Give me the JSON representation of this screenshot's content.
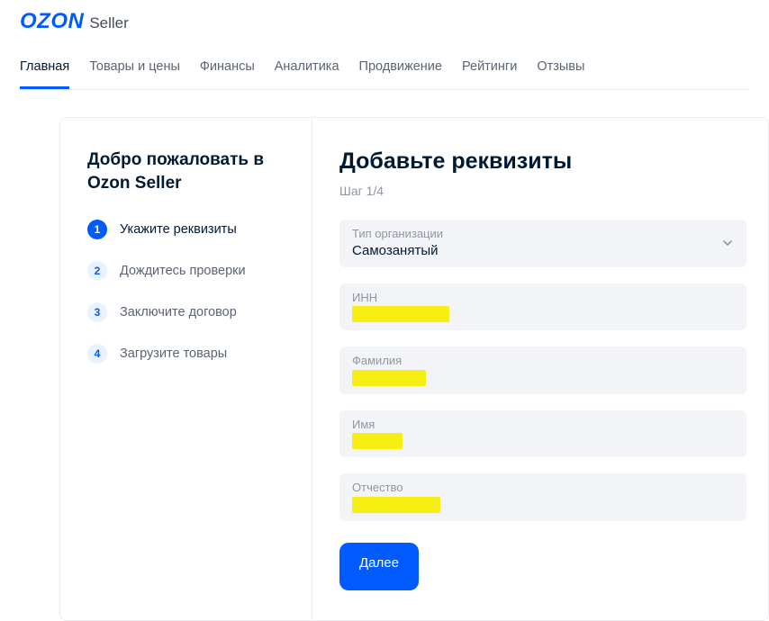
{
  "logo": {
    "brand": "OZON",
    "sub": "Seller"
  },
  "nav": {
    "items": [
      {
        "label": "Главная"
      },
      {
        "label": "Товары и цены"
      },
      {
        "label": "Финансы"
      },
      {
        "label": "Аналитика"
      },
      {
        "label": "Продвижение"
      },
      {
        "label": "Рейтинги"
      },
      {
        "label": "Отзывы"
      }
    ]
  },
  "sidebar": {
    "title": "Добро пожаловать в Ozon Seller",
    "steps": [
      {
        "num": "1",
        "label": "Укажите реквизиты"
      },
      {
        "num": "2",
        "label": "Дождитесь проверки"
      },
      {
        "num": "3",
        "label": "Заключите договор"
      },
      {
        "num": "4",
        "label": "Загрузите товары"
      }
    ]
  },
  "main": {
    "title": "Добавьте реквизиты",
    "sub": "Шаг 1/4",
    "fields": {
      "org_type": {
        "label": "Тип организации",
        "value": "Самозанятый"
      },
      "inn": {
        "label": "ИНН"
      },
      "last_name": {
        "label": "Фамилия"
      },
      "first_name": {
        "label": "Имя"
      },
      "patronymic": {
        "label": "Отчество"
      }
    },
    "next": "Далее"
  }
}
